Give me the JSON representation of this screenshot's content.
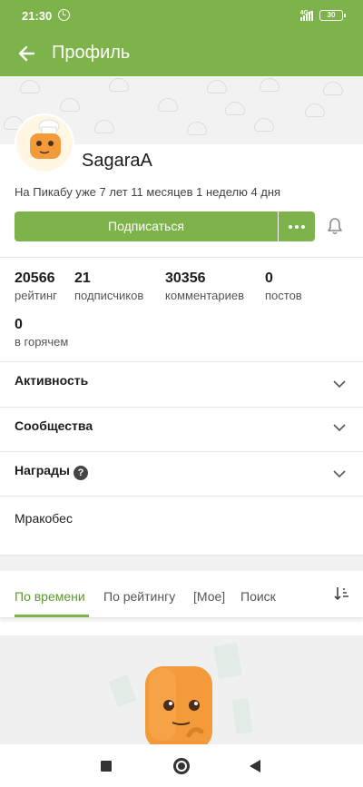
{
  "status_bar": {
    "time": "21:30",
    "network": "4G+",
    "battery": "30"
  },
  "app_bar": {
    "title": "Профиль",
    "back_icon": "arrow-left-icon"
  },
  "profile": {
    "username": "SagaraA",
    "member_since": "На Пикабу уже 7 лет 11 месяцев 1 неделю 4 дня",
    "subscribe_label": "Подписаться",
    "more_icon": "more-dots-icon",
    "bell_icon": "bell-icon"
  },
  "stats": [
    {
      "value": "20566",
      "label": "рейтинг"
    },
    {
      "value": "21",
      "label": "подписчиков"
    },
    {
      "value": "30356",
      "label": "комментариев"
    },
    {
      "value": "0",
      "label": "постов"
    },
    {
      "value": "0",
      "label": "в горячем"
    }
  ],
  "sections": [
    {
      "label": "Активность"
    },
    {
      "label": "Сообщества"
    },
    {
      "label": "Награды",
      "help": "?"
    }
  ],
  "note": "Мракобес",
  "tabs": [
    {
      "label": "По времени",
      "active": true
    },
    {
      "label": "По рейтингу",
      "active": false
    },
    {
      "label": "[Мое]",
      "active": false
    },
    {
      "label": "Поиск",
      "active": false
    }
  ],
  "colors": {
    "brand": "#7db34a",
    "active_tab": "#5a9b2c",
    "mascot": "#f39a3a"
  }
}
